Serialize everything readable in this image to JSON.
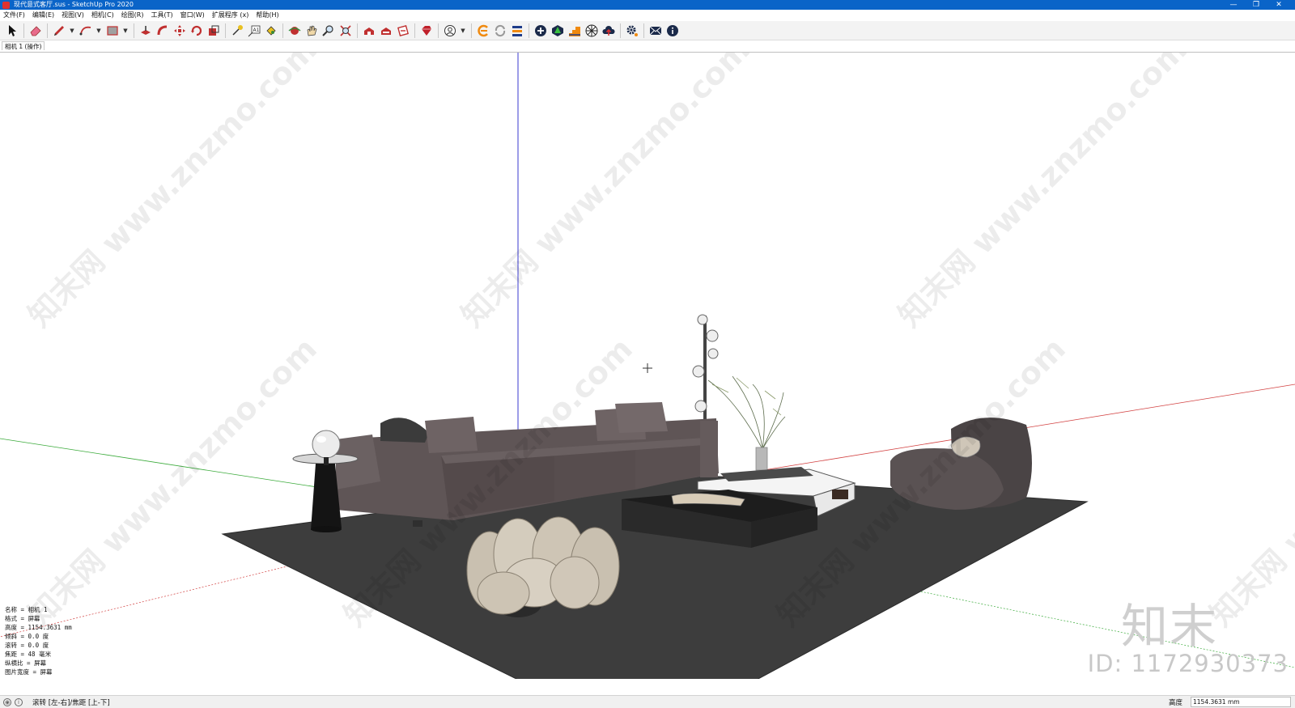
{
  "window": {
    "title": "现代意式客厅.sus - SketchUp Pro 2020",
    "controls": {
      "minimize": "—",
      "restore": "❐",
      "close": "✕"
    }
  },
  "menus": [
    {
      "label": "文件(F)"
    },
    {
      "label": "编辑(E)"
    },
    {
      "label": "视图(V)"
    },
    {
      "label": "相机(C)"
    },
    {
      "label": "绘图(R)"
    },
    {
      "label": "工具(T)"
    },
    {
      "label": "窗口(W)"
    },
    {
      "label": "扩展程序 (x)"
    },
    {
      "label": "帮助(H)"
    }
  ],
  "toolbar": {
    "tools": [
      {
        "icon": "select-arrow-icon"
      },
      {
        "icon": "eraser-icon"
      },
      {
        "icon": "pencil-line-icon"
      },
      {
        "icon": "arc-icon"
      },
      {
        "icon": "rectangle-icon"
      },
      {
        "icon": "push-pull-icon"
      },
      {
        "icon": "follow-me-icon"
      },
      {
        "icon": "move-icon"
      },
      {
        "icon": "rotate-icon"
      },
      {
        "icon": "scale-icon"
      },
      {
        "icon": "tape-measure-icon"
      },
      {
        "icon": "text-label-icon"
      },
      {
        "icon": "paint-bucket-icon"
      },
      {
        "icon": "orbit-icon"
      },
      {
        "icon": "pan-hand-icon"
      },
      {
        "icon": "zoom-icon"
      },
      {
        "icon": "zoom-extents-icon"
      },
      {
        "icon": "warehouse-icon"
      },
      {
        "icon": "extension-warehouse-icon"
      },
      {
        "icon": "layout-icon"
      },
      {
        "icon": "ruby-extension-icon"
      },
      {
        "icon": "account-icon"
      },
      {
        "icon": "plugin-e-icon"
      },
      {
        "icon": "refresh-icon"
      },
      {
        "icon": "layers-icon"
      },
      {
        "icon": "add-circle-icon"
      },
      {
        "icon": "tree-icon"
      },
      {
        "icon": "stairs-icon"
      },
      {
        "icon": "sphere-grid-icon"
      },
      {
        "icon": "cloud-upload-icon"
      },
      {
        "icon": "settings-gear-icon"
      },
      {
        "icon": "mail-icon"
      },
      {
        "icon": "info-icon"
      }
    ]
  },
  "scene_tab": "相机 1 (操作)",
  "watermark_text": "知末网 www.znzmo.com",
  "logo": {
    "brand": "知末",
    "id": "ID: 1172930373"
  },
  "camera_info": [
    "名称 = 相机 1",
    "格式 = 屏幕",
    "高度 = 1154.3631 mm",
    "倾斜 = 0.0 度",
    "滚转 = 0.0 度",
    "焦距 = 48 毫米",
    "纵横比 = 屏幕",
    "图片宽度 = 屏幕"
  ],
  "status": {
    "hint": "滚转 [左-右]/焦距 [上-下]",
    "measurement_label": "高度",
    "measurement_value": "1154.3631 mm"
  }
}
